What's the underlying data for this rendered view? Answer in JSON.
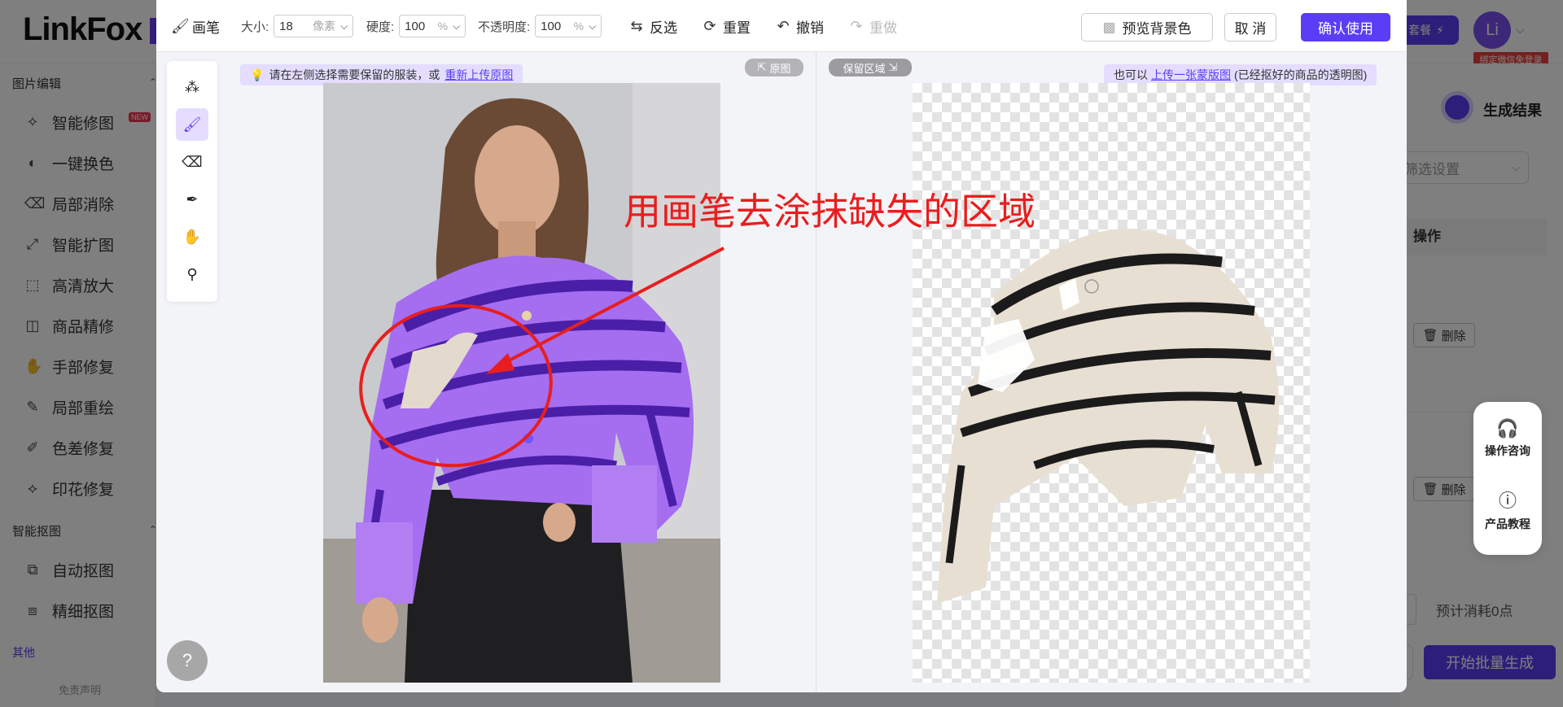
{
  "app": {
    "logo": "LinkFox",
    "upgrade_label": "套餐",
    "avatar_initial": "Li",
    "wechat_tag": "绑定微信免登录"
  },
  "sidebar": {
    "group_edit": "图片编辑",
    "edit_items": [
      {
        "label": "智能修图",
        "icon": "magic-edit-icon",
        "tag": "NEW"
      },
      {
        "label": "一键换色",
        "icon": "color-swap-icon"
      },
      {
        "label": "局部消除",
        "icon": "eraser-icon"
      },
      {
        "label": "智能扩图",
        "icon": "expand-icon"
      },
      {
        "label": "高清放大",
        "icon": "upscale-icon"
      },
      {
        "label": "商品精修",
        "icon": "retouch-icon"
      },
      {
        "label": "手部修复",
        "icon": "hand-icon"
      },
      {
        "label": "局部重绘",
        "icon": "redraw-icon"
      },
      {
        "label": "色差修复",
        "icon": "dropper-icon"
      },
      {
        "label": "印花修复",
        "icon": "pattern-icon"
      }
    ],
    "group_cutout": "智能抠图",
    "cutout_items": [
      {
        "label": "自动抠图",
        "icon": "auto-cutout-icon"
      },
      {
        "label": "精细抠图",
        "icon": "fine-cutout-icon"
      }
    ],
    "group_other": "其他",
    "disclaimer": "免责声明"
  },
  "right_panel": {
    "result_title": "生成结果",
    "filter_placeholder": "筛选设置",
    "ops_header": "操作",
    "delete_label": "删除",
    "consult_label": "操作咨询",
    "tutorial_label": "产品教程",
    "cost_text": "预计消耗0点",
    "start_label": "开始批量生成"
  },
  "toolbar": {
    "brush_label": "画笔",
    "size_label": "大小:",
    "size_value": "18",
    "size_unit": "像素",
    "hardness_label": "硬度:",
    "hardness_value": "100",
    "hardness_unit": "%",
    "opacity_label": "不透明度:",
    "opacity_value": "100",
    "opacity_unit": "%",
    "invert_label": "反选",
    "reset_label": "重置",
    "undo_label": "撤销",
    "redo_label": "重做",
    "preview_bg_label": "预览背景色",
    "cancel_label": "取 消",
    "confirm_label": "确认使用"
  },
  "canvas": {
    "tip_left_text": "请在左侧选择需要保留的服装，或",
    "tip_left_link": "重新上传原图",
    "tip_right_prefix": "也可以",
    "tip_right_link": "上传一张蒙版图",
    "tip_right_suffix": "(已经抠好的商品的透明图)",
    "badge_original": "原图",
    "badge_keep": "保留区域",
    "annotation": "用画笔去涂抹缺失的区域"
  },
  "colors": {
    "accent": "#5b3df5",
    "accent_light": "#e4ddff",
    "annotation_red": "#e81e1e",
    "sweater_purple": "#a56df0",
    "stripe_dark": "#4a1fa8"
  }
}
